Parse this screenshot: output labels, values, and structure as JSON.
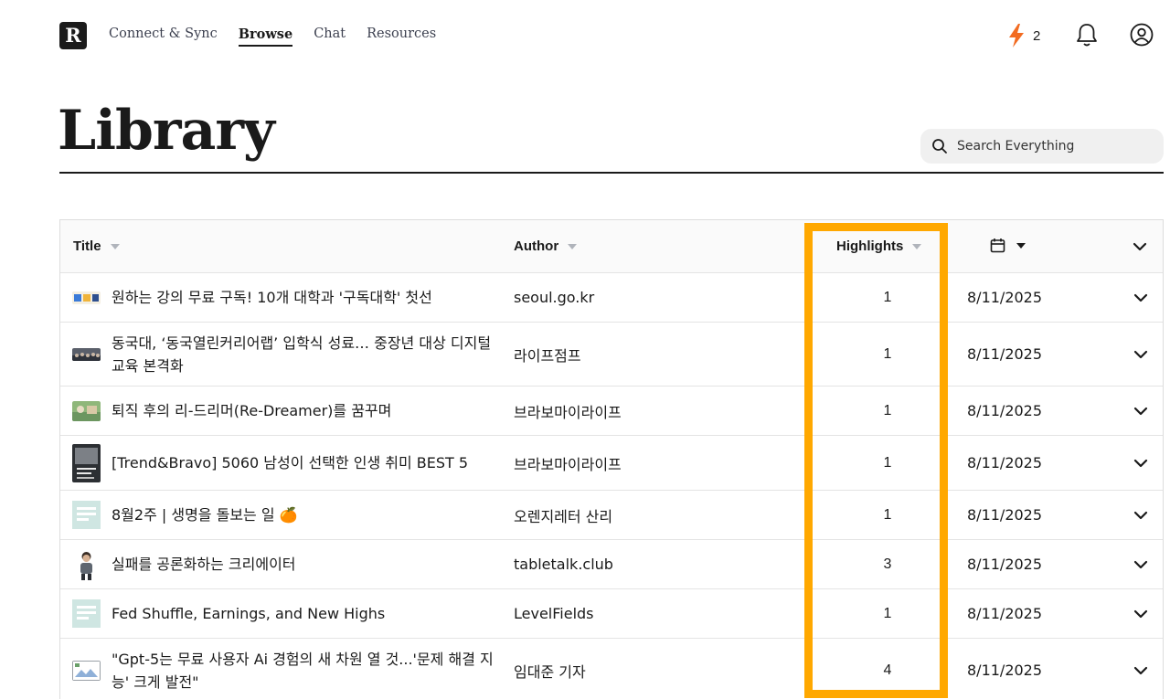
{
  "app": {
    "logo_letter": "R"
  },
  "nav": {
    "items": [
      {
        "label": "Connect & Sync",
        "active": false
      },
      {
        "label": "Browse",
        "active": true
      },
      {
        "label": "Chat",
        "active": false
      },
      {
        "label": "Resources",
        "active": false
      }
    ]
  },
  "header": {
    "streak_count": "2",
    "title": "Library",
    "search_placeholder": "Search Everything"
  },
  "table": {
    "columns": {
      "title": "Title",
      "author": "Author",
      "highlights": "Highlights"
    },
    "rows": [
      {
        "title": "원하는 강의 무료 구독! 10개 대학과 '구독대학' 첫선",
        "author": "seoul.go.kr",
        "highlights": "1",
        "date": "8/11/2025",
        "thumb": "banner"
      },
      {
        "title": "동국대, ‘동국열린커리어랩’ 입학식 성료… 중장년 대상 디지털 교육 본격화",
        "author": "라이프점프",
        "highlights": "1",
        "date": "8/11/2025",
        "thumb": "crowd"
      },
      {
        "title": "퇴직 후의 리-드리머(Re-Dreamer)를 꿈꾸며",
        "author": "브라보마이라이프",
        "highlights": "1",
        "date": "8/11/2025",
        "thumb": "landscape"
      },
      {
        "title": "[Trend&Bravo] 5060 남성이 선택한 인생 취미 BEST 5",
        "author": "브라보마이라이프",
        "highlights": "1",
        "date": "8/11/2025",
        "thumb": "poster"
      },
      {
        "title": "8월2주 | 생명을 돌보는 일 🍊",
        "author": "오렌지레터 산리",
        "highlights": "1",
        "date": "8/11/2025",
        "thumb": "doc"
      },
      {
        "title": "실패를 공론화하는 크리에이터",
        "author": "tabletalk.club",
        "highlights": "3",
        "date": "8/11/2025",
        "thumb": "person"
      },
      {
        "title": "Fed Shuffle, Earnings, and New Highs",
        "author": "LevelFields",
        "highlights": "1",
        "date": "8/11/2025",
        "thumb": "doc"
      },
      {
        "title": "\"Gpt-5는 무료 사용자 Ai 경험의 새 차원 열 것...'문제 해결 지능' 크게 발전\"",
        "author": "임대준 기자",
        "highlights": "4",
        "date": "8/11/2025",
        "thumb": "broken"
      }
    ]
  },
  "colors": {
    "accent_highlight_box": "#ffa800",
    "bolt": "#f26b21",
    "doc_thumb": "#cfe6e2"
  }
}
